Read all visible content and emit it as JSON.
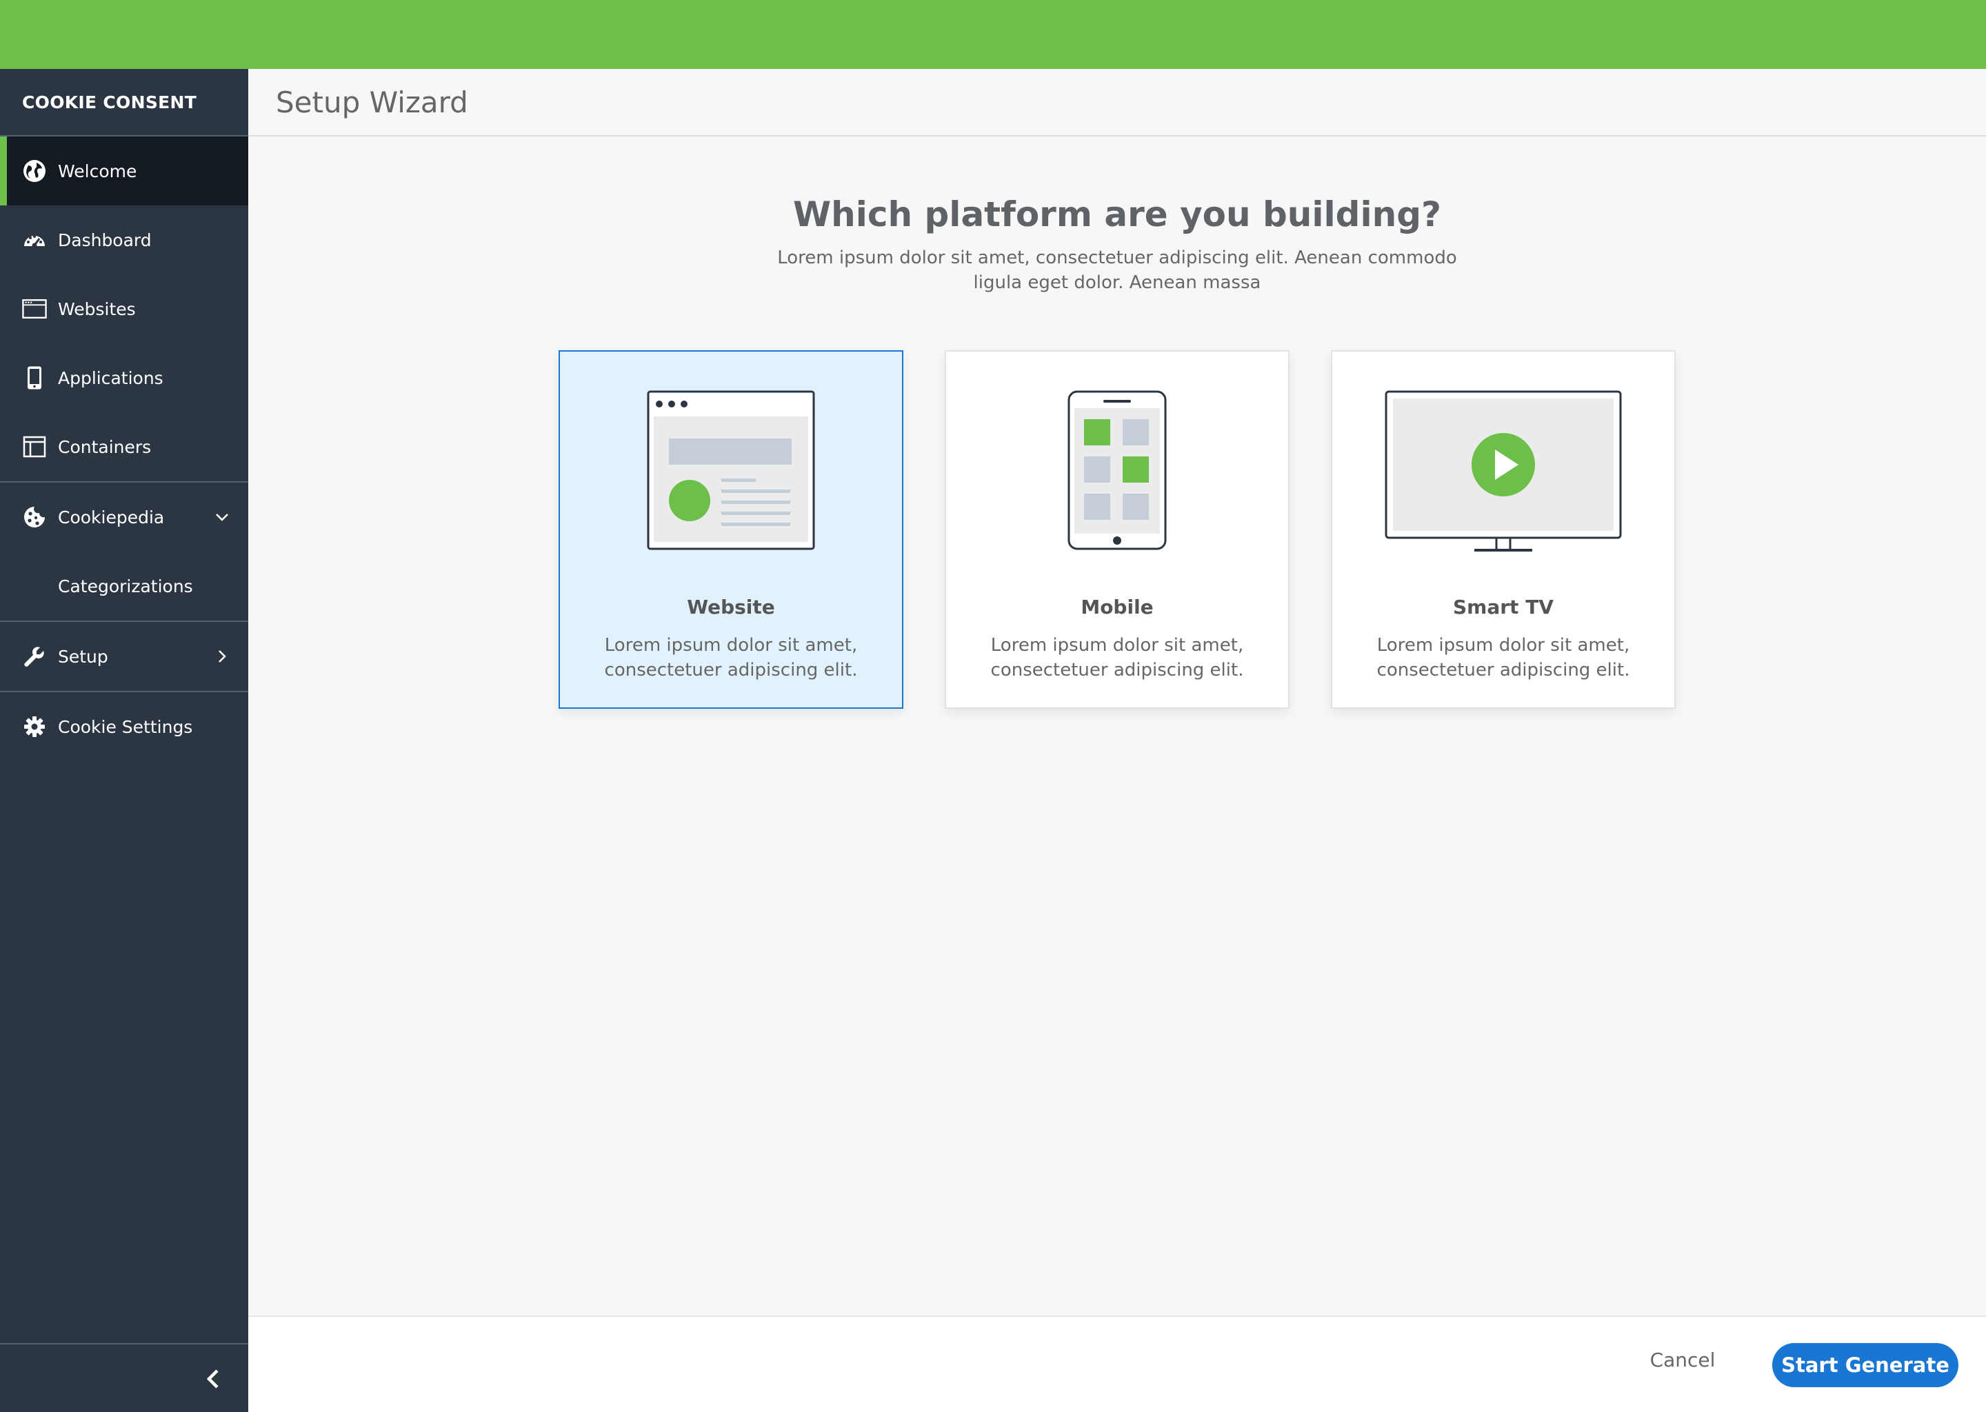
{
  "sidebar": {
    "brand": "COOKIE CONSENT",
    "items": [
      {
        "label": "Welcome",
        "icon": "globe-icon"
      },
      {
        "label": "Dashboard",
        "icon": "gauge-icon"
      },
      {
        "label": "Websites",
        "icon": "browser-window-icon"
      },
      {
        "label": "Applications",
        "icon": "phone-icon"
      },
      {
        "label": "Containers",
        "icon": "layout-icon"
      },
      {
        "label": "Cookiepedia",
        "icon": "cookie-icon"
      },
      {
        "label": "Categorizations"
      },
      {
        "label": "Setup",
        "icon": "wrench-icon"
      },
      {
        "label": "Cookie Settings",
        "icon": "gear-icon"
      }
    ]
  },
  "header": {
    "title": "Setup Wizard"
  },
  "main": {
    "question": "Which platform are you building?",
    "subtitle": "Lorem ipsum dolor sit amet, consectetuer adipiscing elit. Aenean commodo ligula eget dolor. Aenean massa",
    "options": [
      {
        "title": "Website",
        "desc": "Lorem ipsum dolor sit amet, consectetuer adipiscing elit.",
        "selected": true
      },
      {
        "title": "Mobile",
        "desc": "Lorem ipsum dolor sit amet, consectetuer adipiscing elit.",
        "selected": false
      },
      {
        "title": "Smart TV",
        "desc": "Lorem ipsum dolor sit amet, consectetuer adipiscing elit.",
        "selected": false
      }
    ]
  },
  "footer": {
    "cancel": "Cancel",
    "start": "Start Generate"
  },
  "colors": {
    "brand_green": "#6cc04a",
    "sidebar_bg": "#2c3643",
    "primary_blue": "#1976d2",
    "selected_bg": "#e1f2fd"
  }
}
